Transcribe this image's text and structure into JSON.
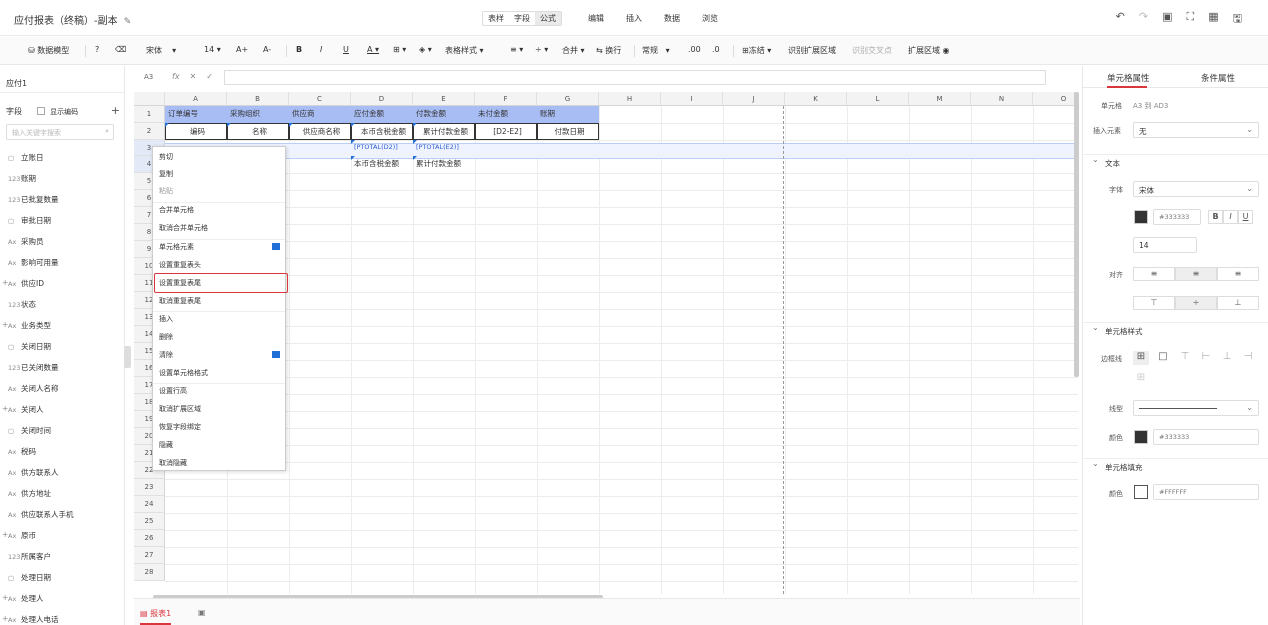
{
  "header": {
    "title": "应付报表（终稿）-副本",
    "mode_tabs": [
      "表样",
      "字段",
      "公式"
    ],
    "active_mode": "公式",
    "menus": [
      "编辑",
      "插入",
      "数据",
      "浏览"
    ]
  },
  "toolbar": {
    "data_model": "数据模型",
    "font": "宋体",
    "font_size": "14",
    "font_inc": "A+",
    "font_dec": "A-",
    "bold": "B",
    "italic": "I",
    "underline": "U",
    "font_color": "A",
    "table_style": "表格样式",
    "merge": "合并",
    "wrap": "换行",
    "number_format": "常规",
    "decimal_inc": ".00",
    "decimal_dec": ".0",
    "freeze": "冻结",
    "identify_expand": "识别扩展区域",
    "identify_cross": "识别交叉点",
    "expand_area": "扩展区域"
  },
  "left_panel": {
    "sheet_name": "应付1",
    "fields_title": "字段",
    "show_code": "显示编码",
    "search_placeholder": "输入关键字搜索",
    "fields": [
      {
        "icon": "date-icon",
        "glyph": "▢",
        "label": "立账日"
      },
      {
        "icon": "number-icon",
        "glyph": "123",
        "label": "账期"
      },
      {
        "icon": "number-icon",
        "glyph": "123",
        "label": "已批复数量"
      },
      {
        "icon": "date-icon",
        "glyph": "▢",
        "label": "审批日期"
      },
      {
        "icon": "text-icon",
        "glyph": "Ax",
        "label": "采购员"
      },
      {
        "icon": "text-icon",
        "glyph": "Ax",
        "label": "影响可用量"
      },
      {
        "icon": "text-icon",
        "glyph": "Ax",
        "label": "供应ID",
        "expandable": true
      },
      {
        "icon": "number-icon",
        "glyph": "123",
        "label": "状态"
      },
      {
        "icon": "text-icon",
        "glyph": "Ax",
        "label": "业务类型",
        "expandable": true
      },
      {
        "icon": "date-icon",
        "glyph": "▢",
        "label": "关闭日期"
      },
      {
        "icon": "number-icon",
        "glyph": "123",
        "label": "已关闭数量"
      },
      {
        "icon": "text-icon",
        "glyph": "Ax",
        "label": "关闭人名称"
      },
      {
        "icon": "text-icon",
        "glyph": "Ax",
        "label": "关闭人",
        "expandable": true
      },
      {
        "icon": "date-icon",
        "glyph": "▢",
        "label": "关闭时间"
      },
      {
        "icon": "text-icon",
        "glyph": "Ax",
        "label": "税码"
      },
      {
        "icon": "text-icon",
        "glyph": "Ax",
        "label": "供方联系人"
      },
      {
        "icon": "text-icon",
        "glyph": "Ax",
        "label": "供方地址"
      },
      {
        "icon": "text-icon",
        "glyph": "Ax",
        "label": "供应联系人手机"
      },
      {
        "icon": "text-icon",
        "glyph": "Ax",
        "label": "原币",
        "expandable": true
      },
      {
        "icon": "number-icon",
        "glyph": "123",
        "label": "所属客户"
      },
      {
        "icon": "date-icon",
        "glyph": "▢",
        "label": "处理日期"
      },
      {
        "icon": "text-icon",
        "glyph": "Ax",
        "label": "处理人",
        "expandable": true
      },
      {
        "icon": "text-icon",
        "glyph": "Ax",
        "label": "处理人电话",
        "expandable": true
      }
    ]
  },
  "formula_bar": {
    "cell_ref": "A3",
    "fx": "fx",
    "value": ""
  },
  "grid": {
    "columns": [
      "A",
      "B",
      "C",
      "D",
      "E",
      "F",
      "G",
      "H",
      "I",
      "J",
      "K",
      "L",
      "M",
      "N",
      "O"
    ],
    "row_labels": [
      "1",
      "2",
      "3",
      "4",
      "5",
      "6",
      "7",
      "8",
      "9",
      "10",
      "11",
      "12",
      "13",
      "14",
      "15",
      "16",
      "17",
      "18",
      "19",
      "20",
      "21",
      "22",
      "23",
      "24",
      "25",
      "26",
      "27",
      "28"
    ],
    "row1": [
      "订单编号",
      "采购组织",
      "供应商",
      "应付金额",
      "付款金额",
      "未付金额",
      "账期"
    ],
    "row2": [
      "编码",
      "名称",
      "供应商名称",
      "本币含税金额",
      "累计付款金额",
      "[D2-E2]",
      "付款日期"
    ],
    "row3": [
      "",
      "",
      "",
      "[PTOTAL(D2)]",
      "[PTOTAL(E2)]",
      "",
      ""
    ],
    "row4": [
      "",
      "",
      "",
      "本币含税金额",
      "累计付款金额",
      "",
      ""
    ]
  },
  "context_menu": {
    "items": [
      "剪切",
      "复制",
      "粘贴",
      "合并单元格",
      "取消合并单元格",
      "单元格元素",
      "设置重复表头",
      "设置重复表尾",
      "取消重复表尾",
      "插入",
      "删除",
      "清除",
      "设置单元格格式",
      "设置行高",
      "取消扩展区域",
      "恢复字段绑定",
      "隐藏",
      "取消隐藏"
    ],
    "highlighted": "设置重复表尾"
  },
  "sheet_tabs": {
    "active": "报表1",
    "add": "+"
  },
  "right_panel": {
    "tabs": [
      "单元格属性",
      "条件属性"
    ],
    "active_tab": "单元格属性",
    "cell_label": "单元格",
    "cell_value": "A3 到 AD3",
    "insert_elem_label": "插入元素",
    "insert_elem_value": "无",
    "text_section": "文本",
    "font_label": "字体",
    "font_value": "宋体",
    "font_color": "#333333",
    "font_size": "14",
    "align_label": "对齐",
    "cell_style_section": "单元格样式",
    "border_label": "边框线",
    "line_label": "线型",
    "color_label": "颜色",
    "border_color": "#333333",
    "fill_section": "单元格填充",
    "fill_label": "颜色",
    "fill_color": "#FFFFFF",
    "bold": "B",
    "italic": "I",
    "underline": "U"
  }
}
